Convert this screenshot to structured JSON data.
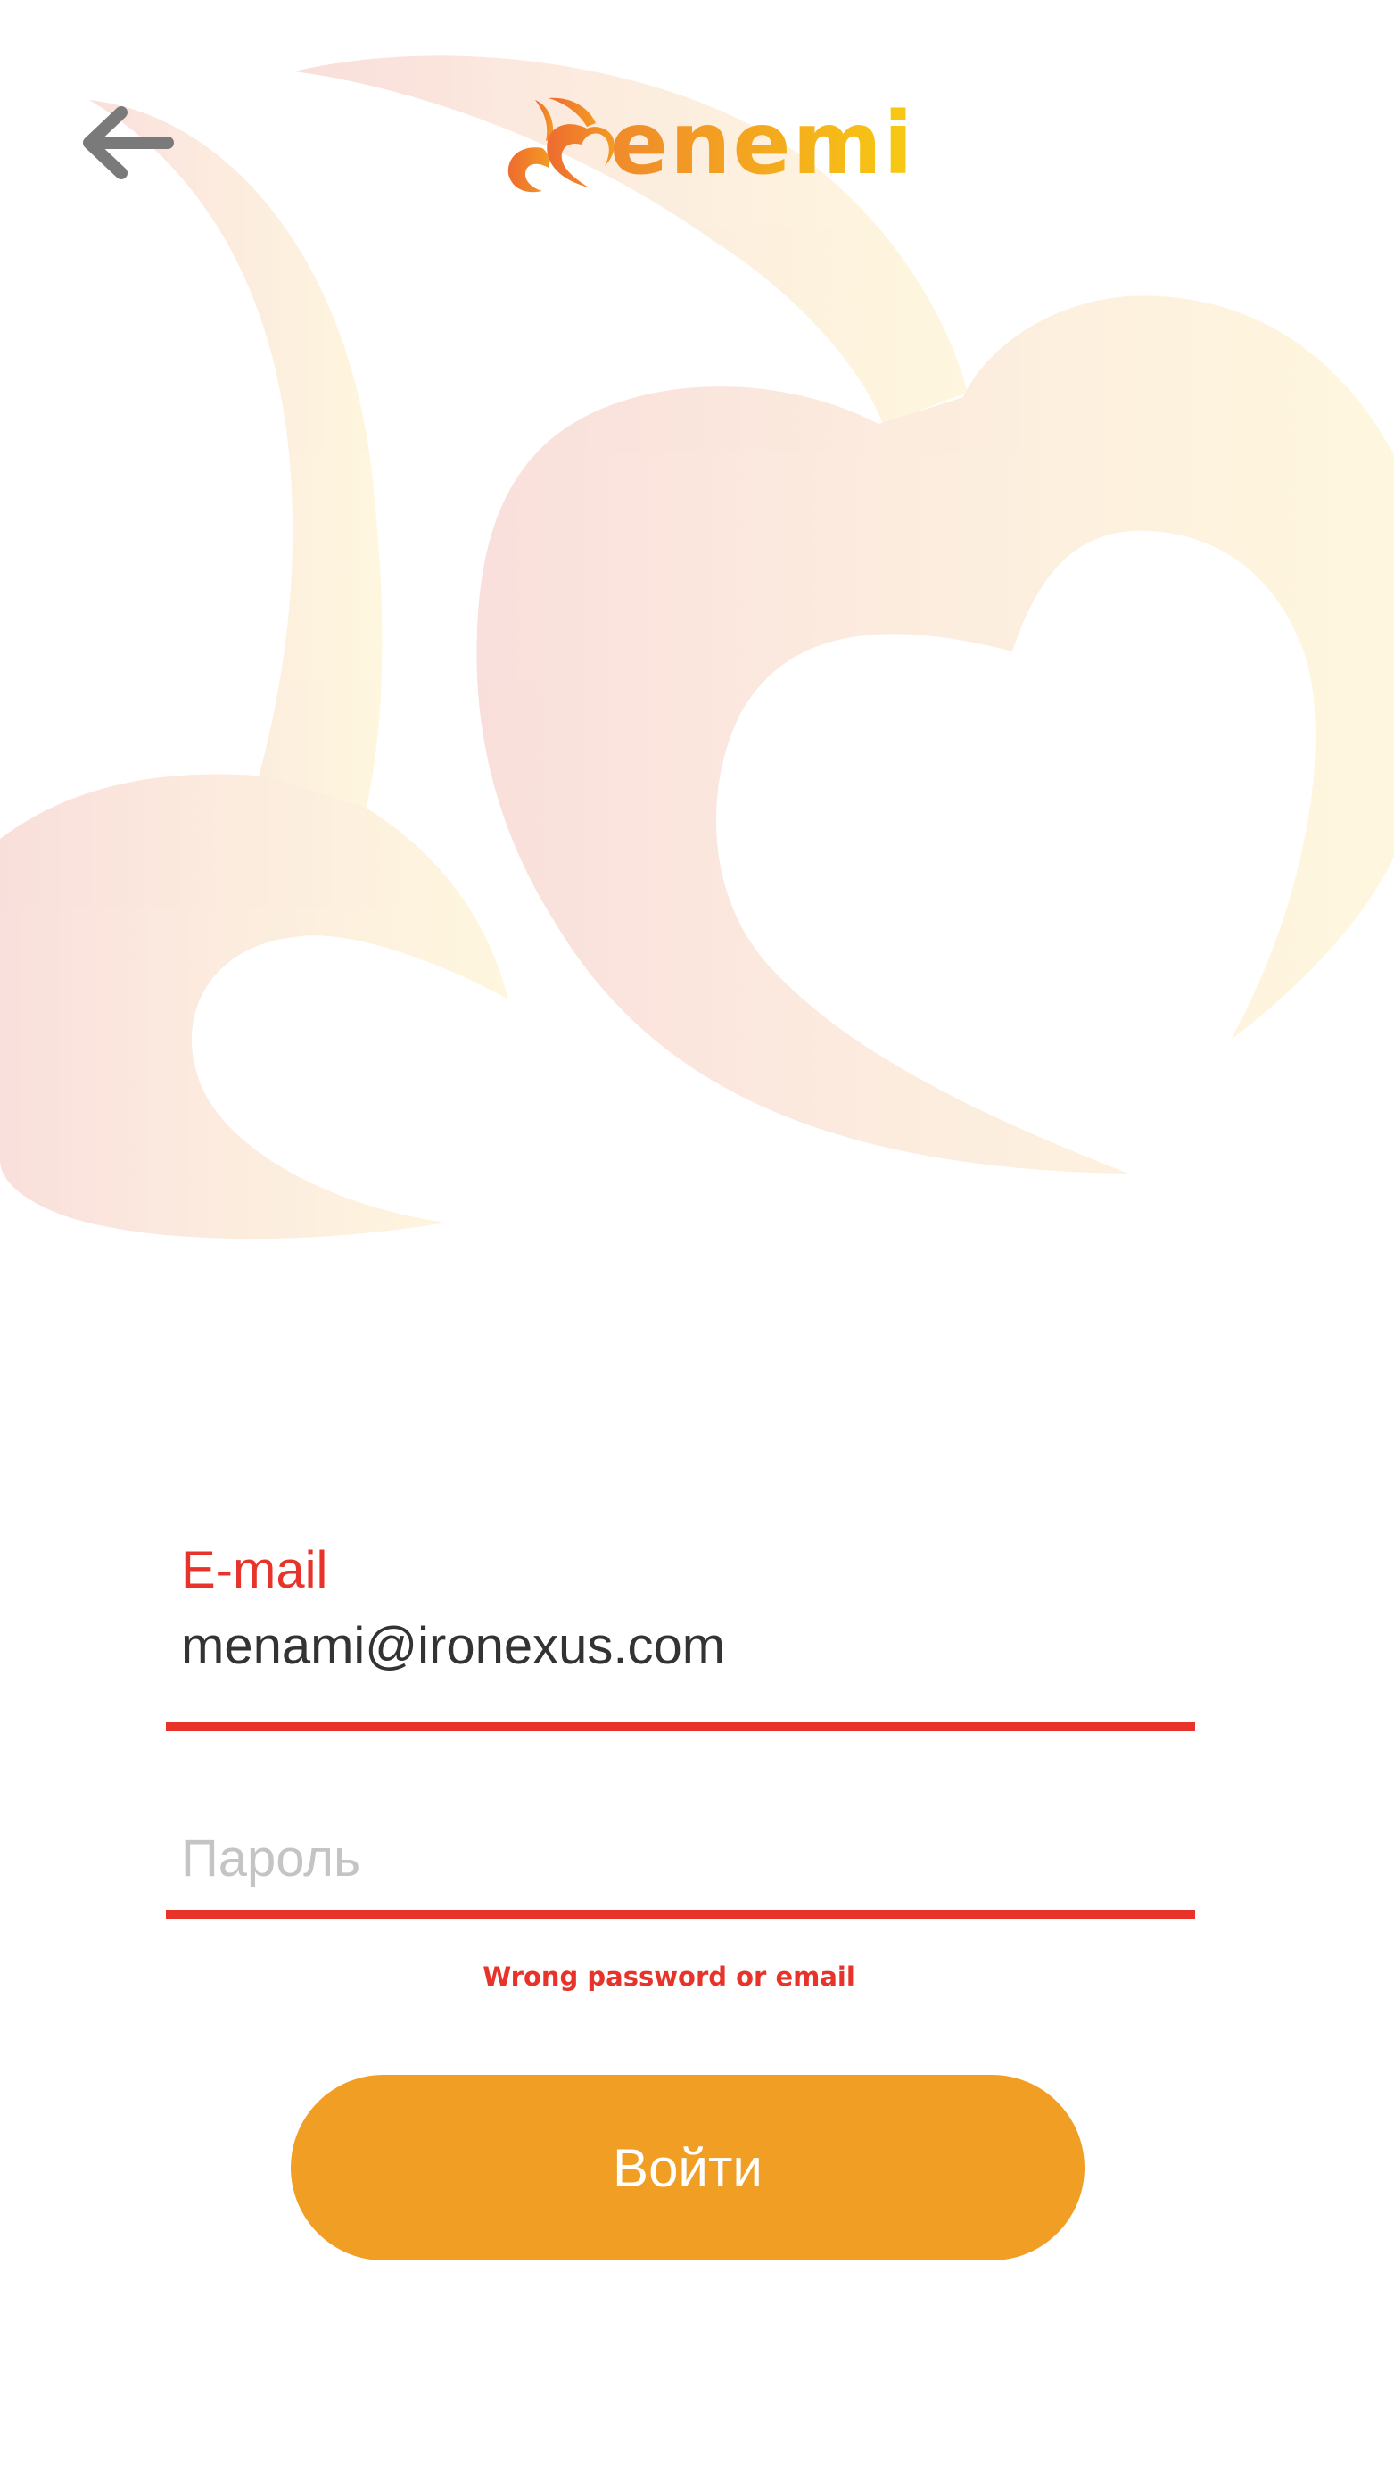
{
  "header": {
    "back_icon": "arrow-left-icon",
    "logo_text": "enemi",
    "logo_icon": "cherry-heart-logo-icon"
  },
  "form": {
    "email": {
      "label": "E-mail",
      "value": "menami@ironexus.com"
    },
    "password": {
      "placeholder": "Пароль",
      "value": ""
    },
    "error_message": "Wrong password or email",
    "submit_label": "Войти"
  },
  "colors": {
    "accent": "#f19e24",
    "error": "#e8332a",
    "logo_start": "#f08a2c",
    "logo_end": "#f7cb12",
    "icon": "#7a7a7a"
  }
}
